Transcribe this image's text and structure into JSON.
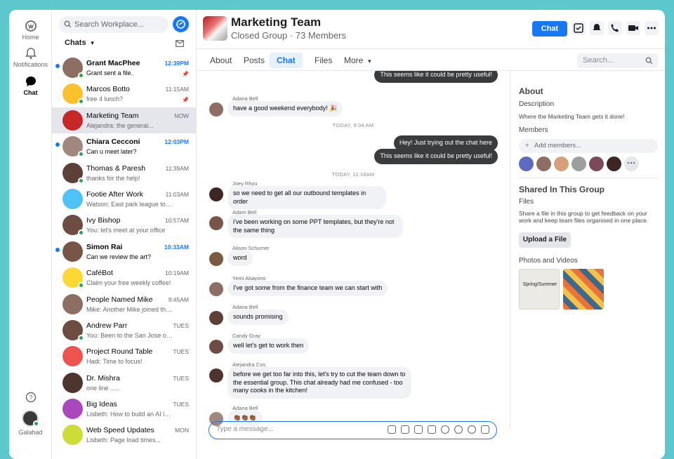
{
  "rail": {
    "home": "Home",
    "notifications": "Notifications",
    "chat": "Chat",
    "user": "Galahad"
  },
  "list": {
    "search_placeholder": "Search Workplace...",
    "header": "Chats",
    "items": [
      {
        "name": "Grant MacPhee",
        "preview": "Grant sent a file.",
        "time": "12:39PM",
        "unread": true,
        "avatar": "#8d6e63",
        "online": true,
        "pinned": true
      },
      {
        "name": "Marcos Botto",
        "preview": "free 4 lunch?",
        "time": "11:15AM",
        "unread": false,
        "avatar": "#fbc02d",
        "online": true,
        "pinned": true
      },
      {
        "name": "Marketing Team",
        "preview": "Alejandra: the general...",
        "time": "NOW",
        "unread": false,
        "avatar": "#c62828",
        "online": false,
        "pinned": false,
        "selected": true
      },
      {
        "name": "Chiara Cecconi",
        "preview": "Can u meet later?",
        "time": "12:03PM",
        "unread": true,
        "avatar": "#a1887f",
        "online": true,
        "pinned": false
      },
      {
        "name": "Thomas & Paresh",
        "preview": "thanks for the help!",
        "time": "11:39AM",
        "unread": false,
        "avatar": "#5d4037",
        "online": true,
        "pinned": false
      },
      {
        "name": "Footie After Work",
        "preview": "Watson: East park league tonight...",
        "time": "11:03AM",
        "unread": false,
        "avatar": "#4fc3f7",
        "online": false,
        "pinned": false
      },
      {
        "name": "Ivy Bishop",
        "preview": "You: let's meet at your office",
        "time": "10:57AM",
        "unread": false,
        "avatar": "#6d4c41",
        "online": true,
        "pinned": false
      },
      {
        "name": "Simon Rai",
        "preview": "Can we review the art?",
        "time": "10:33AM",
        "unread": true,
        "avatar": "#795548",
        "online": false,
        "pinned": false
      },
      {
        "name": "CaféBot",
        "preview": "Claim your free weekly coffee!",
        "time": "10:19AM",
        "unread": false,
        "avatar": "#fdd835",
        "online": true,
        "pinned": false
      },
      {
        "name": "People Named Mike",
        "preview": "Mike: Another Mike joined the team!",
        "time": "9:45AM",
        "unread": false,
        "avatar": "#8d6e63",
        "online": false,
        "pinned": false
      },
      {
        "name": "Andrew Parr",
        "preview": "You: Been to the San Jose office?",
        "time": "TUES",
        "unread": false,
        "avatar": "#6d4c41",
        "online": true,
        "pinned": false
      },
      {
        "name": "Project Round Table",
        "preview": "Hadi: Time to focus!",
        "time": "TUES",
        "unread": false,
        "avatar": "#ef5350",
        "online": false,
        "pinned": false
      },
      {
        "name": "Dr. Mishra",
        "preview": "one line .....",
        "time": "TUES",
        "unread": false,
        "avatar": "#4e342e",
        "online": false,
        "pinned": false
      },
      {
        "name": "Big Ideas",
        "preview": "Lisbeth: How to build an AI loom?",
        "time": "TUES",
        "unread": false,
        "avatar": "#ab47bc",
        "online": false,
        "pinned": false
      },
      {
        "name": "Web Speed Updates",
        "preview": "Lisbeth: Page load times...",
        "time": "MON",
        "unread": false,
        "avatar": "#cddc39",
        "online": false,
        "pinned": false
      }
    ]
  },
  "header": {
    "title": "Marketing Team",
    "subtitle": "Closed Group · 73 Members",
    "chat_button": "Chat",
    "tabs": [
      "About",
      "Posts",
      "Chat",
      "Files",
      "More"
    ],
    "search_placeholder": "Search..."
  },
  "messages": [
    {
      "kind": "me",
      "text": "This seems like it could be pretty useful!"
    },
    {
      "kind": "them",
      "author": "Adana Bell",
      "text": "have a good weekend everybody! 🎉"
    },
    {
      "kind": "day",
      "text": "TODAY, 9:04 AM"
    },
    {
      "kind": "me",
      "text": "Hey! Just trying out the chat here"
    },
    {
      "kind": "me",
      "text": "This seems like it could be pretty useful!"
    },
    {
      "kind": "day",
      "text": "TODAY, 11:18AM"
    },
    {
      "kind": "them",
      "author": "Joey Rhyu",
      "text": "so we need to get all our outbound templates in order"
    },
    {
      "kind": "them",
      "author": "Adam Bell",
      "text": "i've been working on some PPT templates, but they're not the same thing"
    },
    {
      "kind": "them",
      "author": "Alison Schumer",
      "text": "word"
    },
    {
      "kind": "them",
      "author": "Yemi Abayomi",
      "text": "I've got some from the finance team we can start with"
    },
    {
      "kind": "them",
      "author": "Adana Bell",
      "text": "sounds promising"
    },
    {
      "kind": "them",
      "author": "Candy Gray",
      "text": "well let's get to work then"
    },
    {
      "kind": "them",
      "author": "Alejandra Cos",
      "text": "before we get too far into this, let's try to cut the team down to the essential group. This chat already had me confused - too many cooks in the kitchen!"
    },
    {
      "kind": "them",
      "author": "Adana Bell",
      "text": "👏🏾👏🏾👏🏾"
    }
  ],
  "composer_placeholder": "Type a message...",
  "side": {
    "about": "About",
    "description_label": "Description",
    "description": "Where the Marketing Team gets it done!",
    "members_label": "Members",
    "add_members": "Add members...",
    "shared": "Shared In This Group",
    "files_label": "Files",
    "files_text": "Share a file in this group to get feedback on your work and keep team files organised in one place.",
    "upload": "Upload a  File",
    "photos": "Photos and Videos",
    "thumb_text": "Spring/Summer"
  },
  "colors": {
    "accent": "#1877f2",
    "background": "#5cc7cd",
    "online": "#31a24c",
    "bubble_me": "#3a3b3c"
  }
}
